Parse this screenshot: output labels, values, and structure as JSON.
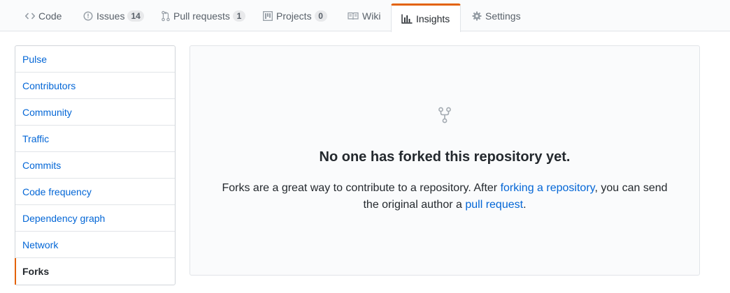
{
  "tabs": [
    {
      "label": "Code",
      "icon": "code-icon"
    },
    {
      "label": "Issues",
      "icon": "issue-opened-icon",
      "count": "14"
    },
    {
      "label": "Pull requests",
      "icon": "git-pull-request-icon",
      "count": "1"
    },
    {
      "label": "Projects",
      "icon": "project-icon",
      "count": "0"
    },
    {
      "label": "Wiki",
      "icon": "book-icon"
    },
    {
      "label": "Insights",
      "icon": "graph-icon",
      "selected": true
    },
    {
      "label": "Settings",
      "icon": "gear-icon"
    }
  ],
  "sidebar": {
    "items": [
      {
        "label": "Pulse"
      },
      {
        "label": "Contributors"
      },
      {
        "label": "Community"
      },
      {
        "label": "Traffic"
      },
      {
        "label": "Commits"
      },
      {
        "label": "Code frequency"
      },
      {
        "label": "Dependency graph"
      },
      {
        "label": "Network"
      },
      {
        "label": "Forks",
        "selected": true
      }
    ]
  },
  "blankslate": {
    "icon": "repo-forked-icon",
    "title": "No one has forked this repository yet.",
    "text_1": "Forks are a great way to contribute to a repository. After ",
    "link_1": "forking a repository",
    "text_2": ", you can send",
    "text_3": "the original author a ",
    "link_2": "pull request",
    "text_4": "."
  },
  "colors": {
    "accent": "#e36209",
    "link": "#0366d6",
    "text": "#24292e",
    "muted": "#586069"
  }
}
